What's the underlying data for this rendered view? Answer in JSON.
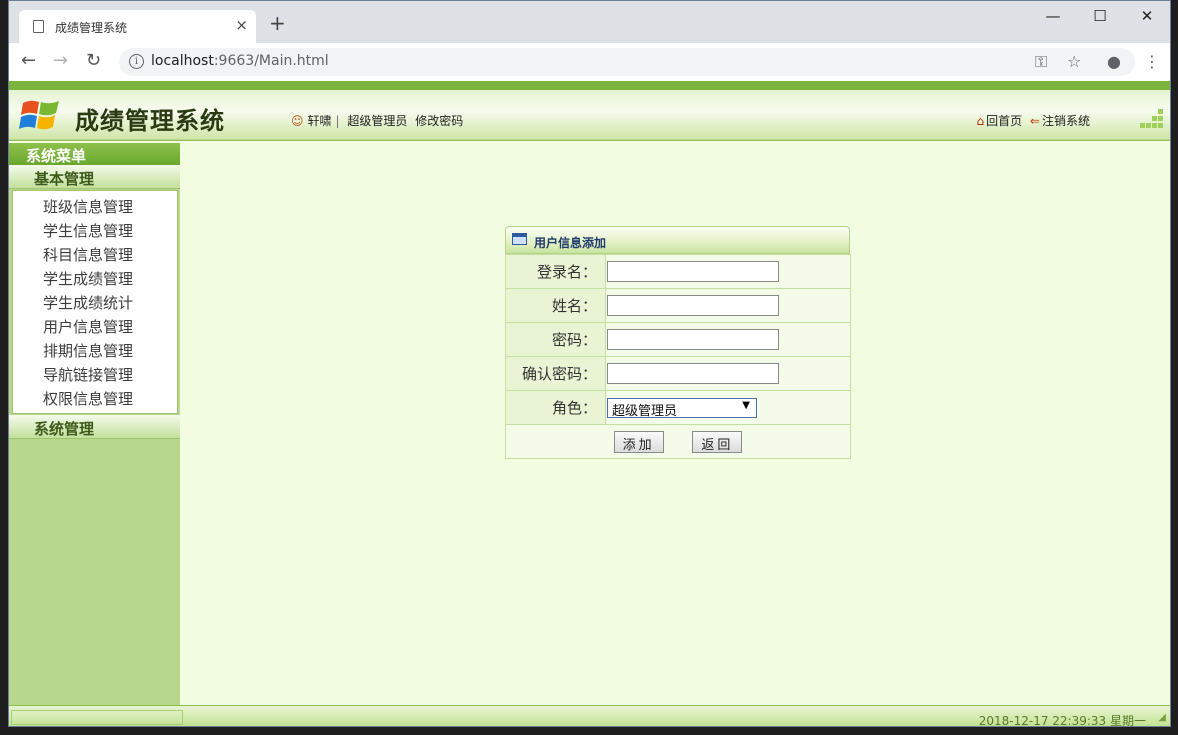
{
  "browser": {
    "tab_title": "成绩管理系统",
    "tab_close": "×",
    "new_tab": "+",
    "url_host": "localhost",
    "url_rest": ":9663/Main.html",
    "controls": {
      "minimize": "—",
      "maximize": "☐",
      "close": "✕"
    },
    "nav": {
      "back": "←",
      "forward": "→",
      "reload": "↻"
    },
    "icons": {
      "info": "i",
      "key": "⚿",
      "star": "☆",
      "account": "●",
      "menu": "⋮"
    }
  },
  "header": {
    "app_title": "成绩管理系统",
    "user_name": "轩啸",
    "separator": "|",
    "role": "超级管理员",
    "change_password": "修改密码",
    "home": "回首页",
    "logout": "注销系统"
  },
  "sidebar": {
    "title": "系统菜单",
    "groups": [
      {
        "label": "基本管理"
      },
      {
        "label": "系统管理"
      }
    ],
    "items": [
      {
        "label": "班级信息管理"
      },
      {
        "label": "学生信息管理"
      },
      {
        "label": "科目信息管理"
      },
      {
        "label": "学生成绩管理"
      },
      {
        "label": "学生成绩统计"
      },
      {
        "label": "用户信息管理"
      },
      {
        "label": "排期信息管理"
      },
      {
        "label": "导航链接管理"
      },
      {
        "label": "权限信息管理"
      }
    ]
  },
  "form": {
    "title": "用户信息添加",
    "fields": [
      {
        "label": "登录名：",
        "value": ""
      },
      {
        "label": "姓名：",
        "value": ""
      },
      {
        "label": "密码：",
        "value": ""
      },
      {
        "label": "确认密码：",
        "value": ""
      }
    ],
    "role_label": "角色：",
    "role_selected": "超级管理员",
    "role_arrow": "▼",
    "add_button": "添加",
    "back_button": "返回"
  },
  "status": {
    "datetime": "2018-12-17 22:39:33 星期一"
  },
  "colors": {
    "accent_green": "#7cb33d",
    "sidebar_bg": "#b7d88c",
    "content_bg": "#f1fce0"
  }
}
